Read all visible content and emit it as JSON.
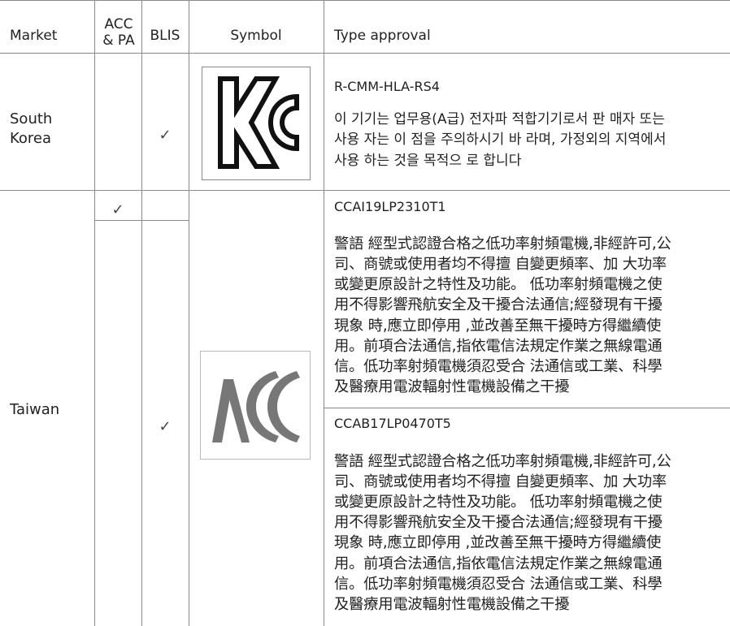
{
  "table": {
    "headers": {
      "market": "Market",
      "acc_pa_line1": "ACC",
      "acc_pa_line2": "& PA",
      "blis": "BLIS",
      "symbol": "Symbol",
      "type_approval": "Type approval"
    },
    "rows": [
      {
        "market_line1": "South",
        "market_line2": "Korea",
        "acc_pa_check": "",
        "blis_check": "✓",
        "symbol_icon": "kc-mark-icon",
        "approval_code": "R-CMM-HLA-RS4",
        "approval_text_lines": [
          "이 기기는 업무용(A급) 전자파 적합기기로서 판 매자 또는",
          "사용 자는 이 점을 주의하시기 바 라며, 가정외의 지역에서",
          "사용 하는 것을 목적으 로 합니다"
        ]
      },
      {
        "market": "Taiwan",
        "symbol_icon": "ncc-mark-icon",
        "entries": [
          {
            "acc_pa_check": "✓",
            "blis_check": "",
            "approval_code": "CCAI19LP2310T1",
            "approval_text_lines": [
              "警語 經型式認證合格之低功率射頻電機,非經許可,公",
              "司、商號或使用者均不得擅 自變更頻率、加 大功率",
              "或變更原設計之特性及功能。 低功率射頻電機之使",
              "用不得影響飛航安全及干擾合法通信;經發現有干擾",
              "現象 時,應立即停用 ,並改善至無干擾時方得繼續使",
              "用。前項合法通信,指依電信法規定作業之無線電通",
              "信。低功率射頻電機須忍受合 法通信或工業、科學",
              "及醫療用電波輻射性電機設備之干擾"
            ]
          },
          {
            "acc_pa_check": "",
            "blis_check": "✓",
            "approval_code": "CCAB17LP0470T5",
            "approval_text_lines": [
              "警語 經型式認證合格之低功率射頻電機,非經許可,公",
              "司、商號或使用者均不得擅 自變更頻率、加 大功率",
              "或變更原設計之特性及功能。 低功率射頻電機之使",
              "用不得影響飛航安全及干擾合法通信;經發現有干擾",
              "現象 時,應立即停用 ,並改善至無干擾時方得繼續使",
              "用。前項合法通信,指依電信法規定作業之無線電通",
              "信。低功率射頻電機須忍受合 法通信或工業、科學",
              "及醫療用電波輻射性電機設備之干擾"
            ]
          }
        ]
      }
    ]
  }
}
